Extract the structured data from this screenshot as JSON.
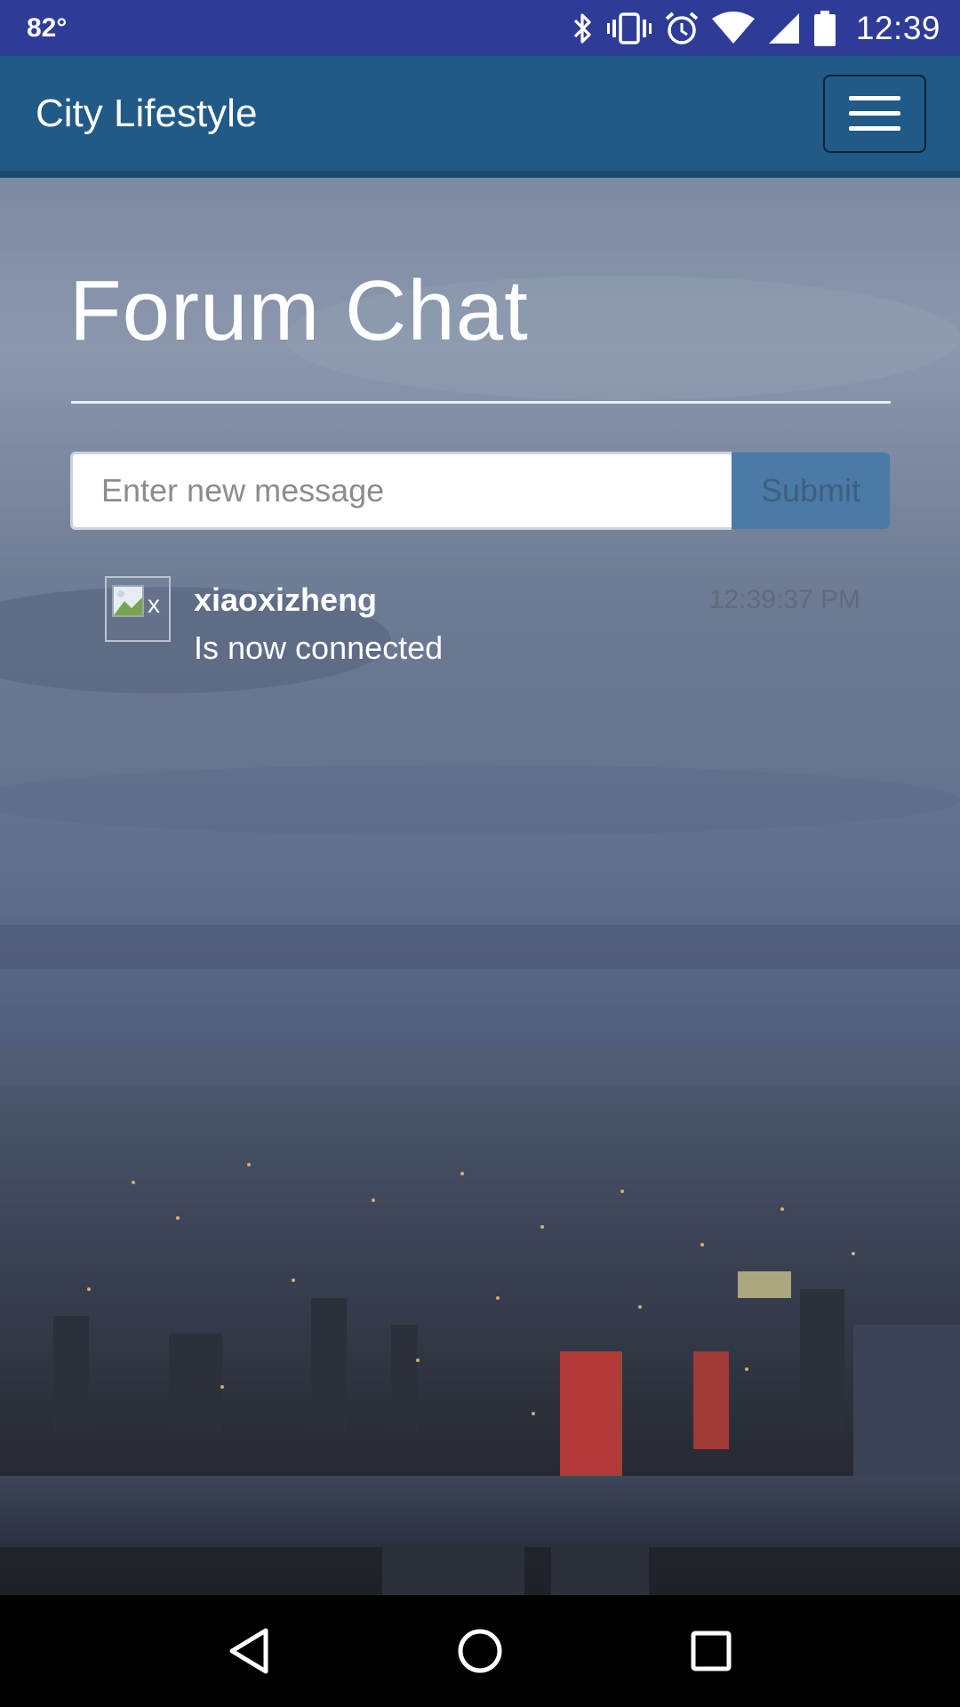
{
  "status_bar": {
    "temperature": "82°",
    "time": "12:39",
    "icons": [
      "bluetooth-icon",
      "vibrate-icon",
      "alarm-icon",
      "wifi-icon",
      "signal-icon",
      "battery-icon"
    ]
  },
  "app_bar": {
    "brand": "City Lifestyle",
    "menu_icon": "hamburger-menu-icon"
  },
  "page": {
    "title": "Forum Chat"
  },
  "message_form": {
    "placeholder": "Enter new message",
    "value": "",
    "submit_label": "Submit"
  },
  "messages": [
    {
      "avatar_alt": "x",
      "username": "xiaoxizheng",
      "text": "Is now connected",
      "time": "12:39:37 PM"
    }
  ],
  "nav_bar": {
    "buttons": [
      "back-icon",
      "home-icon",
      "recents-icon"
    ]
  },
  "colors": {
    "status_bar": "#2e3b97",
    "app_bar": "#215a86",
    "submit_button": "#4a7aa6"
  }
}
